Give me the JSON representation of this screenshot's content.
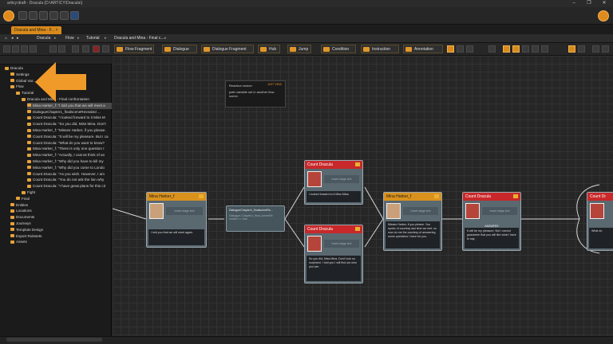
{
  "window": {
    "title": "articy:draft - Dracula (D:\\ARTICY\\Dracula\\)",
    "controls": [
      "–",
      "❐",
      "✕"
    ]
  },
  "tabs": [
    {
      "label": "Dracula and Mina - F... ×"
    }
  ],
  "breadcrumbs": [
    "Dracula",
    "Flow",
    "Tutorial",
    "Dracula and Mina - Final c..."
  ],
  "node_toolbar": {
    "flow_fragment": "Flow Fragment",
    "dialogue": "Dialogue",
    "dialogue_fragment": "Dialogue Fragment",
    "hub": "Hub",
    "jump": "Jump",
    "condition": "Condition",
    "instruction": "Instruction",
    "annotation": "Annotation"
  },
  "tree": [
    {
      "label": "Dracula",
      "level": 0
    },
    {
      "label": "Settings",
      "level": 1
    },
    {
      "label": "Global Var...",
      "level": 1
    },
    {
      "label": "Flow",
      "level": 1
    },
    {
      "label": "Tutorial",
      "level": 2
    },
    {
      "label": "Dracula and Mina - Final confrontation",
      "level": 3
    },
    {
      "label": "Mina Harker_f: \"I told you that we will meet a",
      "level": 4
    },
    {
      "label": "DialogueChapter1_finalsceneRevealed ...",
      "level": 4
    },
    {
      "label": "Count Dracula: \"I looked forward to it Miss M",
      "level": 4
    },
    {
      "label": "Count Dracula: \"So you did, Miss Mina.  Don't",
      "level": 4
    },
    {
      "label": "Mina Harker_f: \"Misses Harker, if you please.",
      "level": 4
    },
    {
      "label": "Count Dracula: \"It will be my pleasure. But I ca",
      "level": 4
    },
    {
      "label": "Count Dracula: \"What do you want to know?",
      "level": 4
    },
    {
      "label": "Mina Harker_f: \"There is only one question I",
      "level": 4
    },
    {
      "label": "Mina Harker_f: \"Actually, I cannot think of an",
      "level": 4
    },
    {
      "label": "Mina Harker_f: \"Why did you have to kill my",
      "level": 4
    },
    {
      "label": "Mina Harker_f: \"Why did you come to Londo",
      "level": 4
    },
    {
      "label": "Count Dracula: \"As you wish. However, I am",
      "level": 4
    },
    {
      "label": "Count Dracula: \"You do not ask the lion why",
      "level": 4
    },
    {
      "label": "Count Dracula: \"I have great plans for this cit",
      "level": 4
    },
    {
      "label": "Fight",
      "level": 3
    },
    {
      "label": "Final",
      "level": 2
    },
    {
      "label": "Entities",
      "level": 1
    },
    {
      "label": "Locations",
      "level": 1
    },
    {
      "label": "Documents",
      "level": 1
    },
    {
      "label": "Journeys",
      "level": 1
    },
    {
      "label": "Template Design",
      "level": 1
    },
    {
      "label": "Export Rulesets",
      "level": 1
    },
    {
      "label": "Assets",
      "level": 1
    }
  ],
  "note": {
    "tag": "JUST VIEW",
    "title": "Reaction choice:",
    "text": "path variable set in another flow scene."
  },
  "condition_node": {
    "text": "DialogueChapter1_finalsceneRe..."
  },
  "condition_code": "Dialogue.Chapter1_final_sceneRe\nvealed == true",
  "nodes": {
    "mina1": {
      "speaker": "Mina Harker_f",
      "placeholder": "Insert stage text",
      "text": "I told you that we will meet again."
    },
    "dracula_top": {
      "speaker": "Count Dracula",
      "placeholder": "Insert stage text",
      "text": "I looked forward to it Miss Mina."
    },
    "dracula_bottom": {
      "speaker": "Count Dracula",
      "placeholder": "Insert stage text",
      "text": "So you did, Miss Mina.\nDon't look so surprised. I told you I will find out who you are."
    },
    "mina2": {
      "speaker": "Mina Harker_f",
      "placeholder": "Insert stage text",
      "text": "Misses Harker, if you please. You spoke of courtesy last time we met, so now do me the courtesy of answering some questions I have for you."
    },
    "dracula_right": {
      "speaker": "Count Dracula",
      "label": "ANSWERS",
      "placeholder": "Insert stage text",
      "text": "It will be my pleasure. But I cannot guarantee that you will like what I have to say."
    },
    "dracula_edge": {
      "speaker": "Count Dr",
      "text": "What do"
    }
  }
}
